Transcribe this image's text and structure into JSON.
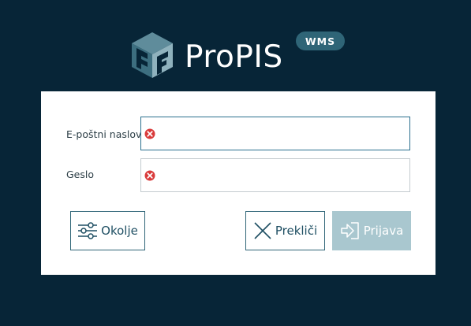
{
  "brand": {
    "name": "ProPIS",
    "badge": "WMS"
  },
  "form": {
    "email": {
      "label": "E-poštni naslov",
      "value": "",
      "state": "error",
      "icon": "error-icon"
    },
    "password": {
      "label": "Geslo",
      "value": "",
      "state": "error",
      "icon": "error-icon"
    }
  },
  "buttons": {
    "environment": {
      "label": "Okolje",
      "icon": "sliders-icon"
    },
    "cancel": {
      "label": "Prekliči",
      "icon": "close-icon"
    },
    "login": {
      "label": "Prijava",
      "icon": "sign-in-icon",
      "disabled": true
    }
  },
  "colors": {
    "background": "#072537",
    "card": "#ffffff",
    "accent": "#2f6577",
    "error": "#d93b3b",
    "login_disabled": "#a9c7cf"
  }
}
